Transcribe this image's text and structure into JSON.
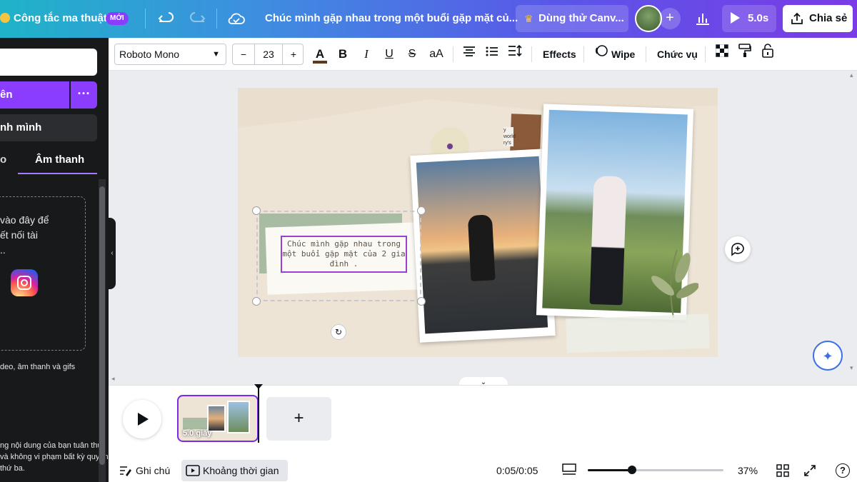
{
  "header": {
    "magic_switch": "Công tắc ma thuật",
    "badge_new": "MỚI",
    "doc_title": "Chúc mình gặp nhau trong một buổi gặp mặt củ...",
    "try_canva": "Dùng thử Canv...",
    "play_duration": "5.0s",
    "share": "Chia sẻ"
  },
  "left_panel": {
    "upload_label": "ên",
    "record_label": "nh mình",
    "tab_video": "o",
    "tab_audio": "Âm thanh",
    "drop_line1": "vào đây để",
    "drop_line2": "ết nối tài",
    "drop_line3": "..",
    "types_note": "deo, âm thanh và gifs",
    "legal_line1": "ng nội dung của bạn tuân thủ",
    "legal_line2": "và không vi phạm bất kỳ quyền",
    "legal_line3": "thứ ba."
  },
  "toolbar": {
    "font_family": "Roboto Mono",
    "font_size": "23",
    "minus": "−",
    "plus": "+",
    "effects": "Effects",
    "animation": "Wipe",
    "position": "Chức vụ"
  },
  "canvas": {
    "text_content": "Chúc mình gặp nhau trong một buổi gặp mặt của 2 gia đình .",
    "paper_scrap_text": "y world ry's"
  },
  "timeline": {
    "page_duration": "5.0 giây"
  },
  "footer": {
    "notes": "Ghi chú",
    "timeline_label": "Khoảng thời gian",
    "time": "0:05/0:05",
    "zoom": "37%"
  },
  "colors": {
    "accent": "#8b3dff",
    "selection": "#9a3fcf",
    "magic": "#3b6fe6"
  }
}
